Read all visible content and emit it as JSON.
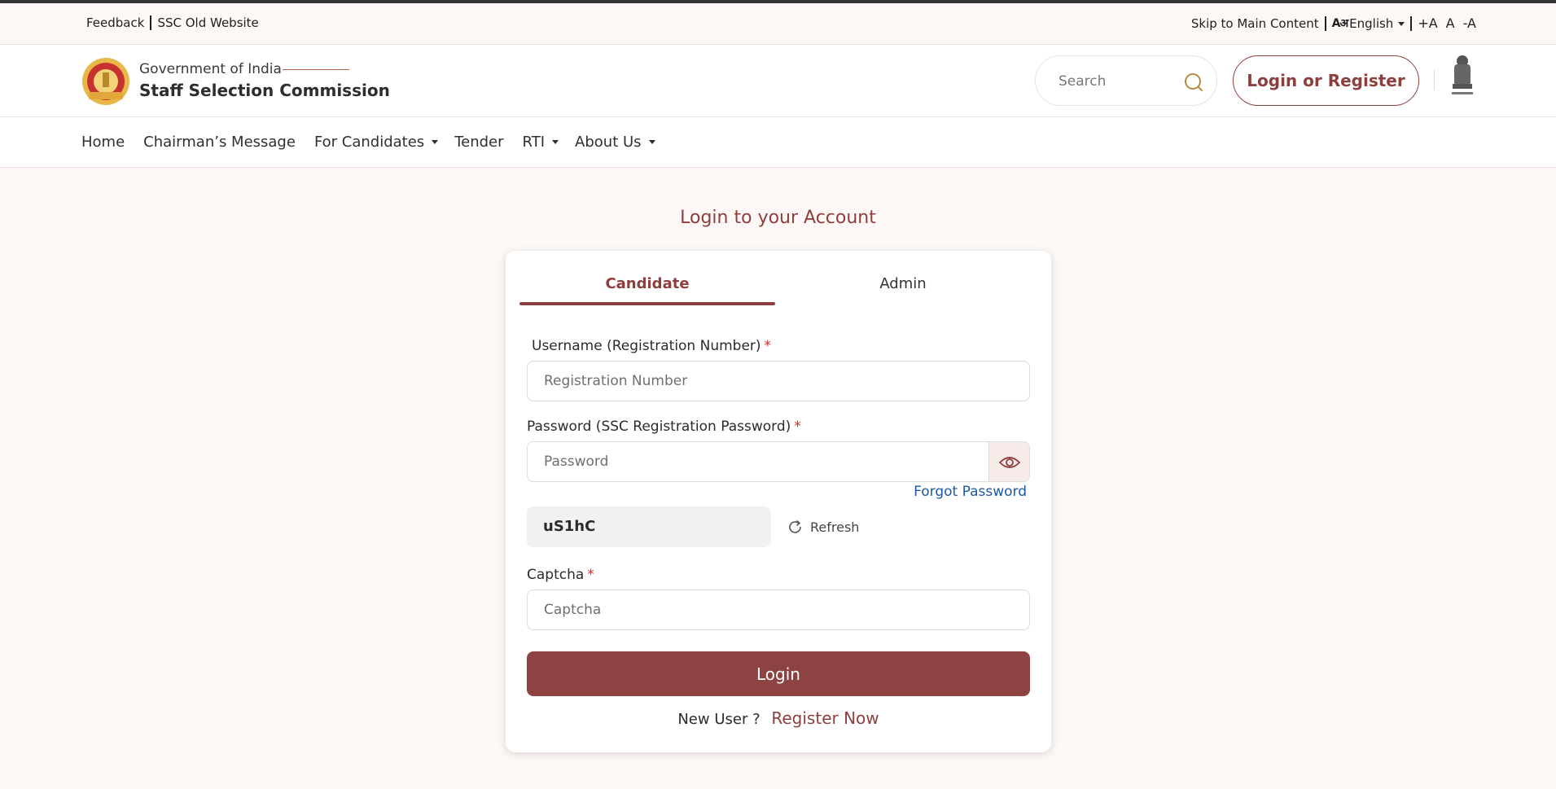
{
  "utility": {
    "feedback": "Feedback",
    "old_website": "SSC Old Website",
    "skip": "Skip to Main Content",
    "lang_glyph": "Aअ",
    "language": "English",
    "font_increase": "+A",
    "font_normal": "A",
    "font_decrease": "-A"
  },
  "header": {
    "gov": "Government of India",
    "org": "Staff Selection Commission",
    "search_placeholder": "Search",
    "login_register": "Login or Register"
  },
  "nav": {
    "items": [
      "Home",
      "Chairman’s Message",
      "For Candidates",
      "Tender",
      "RTI",
      "About Us"
    ]
  },
  "main": {
    "title": "Login to your Account",
    "tabs": [
      "Candidate",
      "Admin"
    ],
    "username_label": "Username (Registration Number)",
    "username_placeholder": "Registration Number",
    "password_label": "Password (SSC Registration Password)",
    "password_placeholder": "Password",
    "forgot": "Forgot Password",
    "captcha_code": "uS1hC",
    "refresh": "Refresh",
    "captcha_label": "Captcha",
    "captcha_placeholder": "Captcha",
    "login": "Login",
    "new_user": "New User ?",
    "register": "Register Now",
    "required_mark": "*"
  },
  "colors": {
    "brand": "#8d3f3d",
    "link": "#1a5aa8",
    "required": "#d62828",
    "background": "#fdf8f6"
  },
  "icons": [
    "search-icon",
    "eye-icon",
    "refresh-icon",
    "ssc-logo",
    "national-emblem",
    "language-icon",
    "chevron-down-icon"
  ]
}
